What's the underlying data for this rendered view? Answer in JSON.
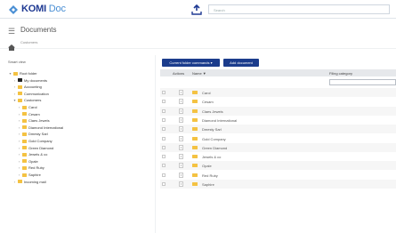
{
  "app": {
    "logo_brand": "KOMI",
    "logo_suffix": "Doc",
    "search_placeholder": "Search"
  },
  "header": {
    "title": "Documents",
    "breadcrumb": "Customers"
  },
  "sidebar": {
    "heading": "Smart view",
    "tree": [
      {
        "label": "Root folder",
        "indent": 0,
        "expanded": true,
        "icon": "folder"
      },
      {
        "label": "My documents",
        "indent": 1,
        "expanded": false,
        "icon": "folder-dark"
      },
      {
        "label": "Accounting",
        "indent": 1,
        "expanded": false,
        "icon": "folder"
      },
      {
        "label": "Communication",
        "indent": 1,
        "expanded": false,
        "icon": "folder"
      },
      {
        "label": "Customers",
        "indent": 1,
        "expanded": true,
        "icon": "folder"
      },
      {
        "label": "Carol",
        "indent": 2,
        "expanded": false,
        "icon": "folder"
      },
      {
        "label": "Cesam",
        "indent": 2,
        "expanded": false,
        "icon": "folder"
      },
      {
        "label": "Claes Jewels",
        "indent": 2,
        "expanded": false,
        "icon": "folder"
      },
      {
        "label": "Diamond International",
        "indent": 2,
        "expanded": false,
        "icon": "folder"
      },
      {
        "label": "Dmesty Sarl",
        "indent": 2,
        "expanded": false,
        "icon": "folder"
      },
      {
        "label": "Gold Company",
        "indent": 2,
        "expanded": false,
        "icon": "folder"
      },
      {
        "label": "Green Diamond",
        "indent": 2,
        "expanded": false,
        "icon": "folder"
      },
      {
        "label": "Jewels & co",
        "indent": 2,
        "expanded": false,
        "icon": "folder"
      },
      {
        "label": "Opale",
        "indent": 2,
        "expanded": false,
        "icon": "folder"
      },
      {
        "label": "Red Ruby",
        "indent": 2,
        "expanded": false,
        "icon": "folder"
      },
      {
        "label": "Saphire",
        "indent": 2,
        "expanded": false,
        "icon": "folder"
      },
      {
        "label": "Incoming mail",
        "indent": 1,
        "expanded": false,
        "icon": "folder"
      }
    ]
  },
  "toolbar": {
    "folder_commands_label": "Current folder commands ▾",
    "add_document_label": "Add document"
  },
  "table": {
    "columns": [
      "Actions",
      "Name ▼",
      "Filing category"
    ],
    "rows": [
      {
        "name": "Carol"
      },
      {
        "name": "Cesam"
      },
      {
        "name": "Claes Jewels"
      },
      {
        "name": "Diamond International"
      },
      {
        "name": "Dmesty Sarl"
      },
      {
        "name": "Gold Company"
      },
      {
        "name": "Green Diamond"
      },
      {
        "name": "Jewels & co"
      },
      {
        "name": "Opale"
      },
      {
        "name": "Red Ruby"
      },
      {
        "name": "Saphire"
      }
    ]
  },
  "colors": {
    "brand": "#1f3a93",
    "button": "#1b3c8c",
    "folder": "#f4c242"
  }
}
